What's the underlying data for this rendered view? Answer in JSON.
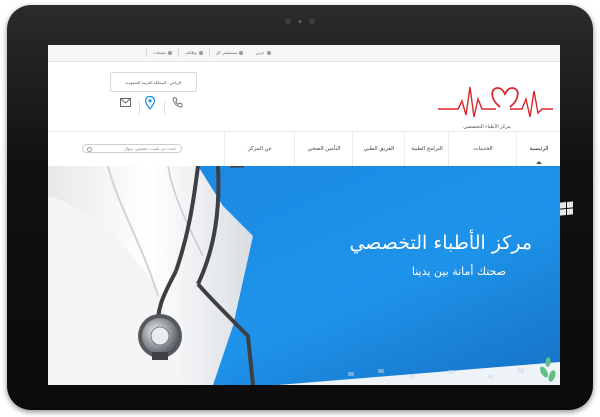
{
  "top_links": [
    {
      "label": "عربي",
      "icon": "globe-icon"
    },
    {
      "label": "مستشفى كل",
      "icon": "phone-icon"
    },
    {
      "label": "وظائف",
      "icon": "briefcase-icon"
    },
    {
      "label": "صفحات",
      "icon": "doc-icon"
    }
  ],
  "logo": {
    "text": "مركز الأطباء التخصصي",
    "color": "#d8262e"
  },
  "contact": {
    "address": "الرياض - المملكة العربية السعودية"
  },
  "nav": {
    "items": [
      "الرئيسية",
      "الخدمات",
      "البرامج الطبية",
      "الفريق الطبي",
      "التأمين الصحي",
      "عن المركز"
    ],
    "active": "الرئيسية"
  },
  "search": {
    "placeholder": "ابحث عن طبيب، تخصص، سؤال"
  },
  "hero": {
    "title": "مركز الأطباء التخصصي",
    "subtitle": "صحتك أمانة بين يدينا",
    "accent": "#1e8fe6"
  },
  "colors": {
    "nav_icon": "#1e8fe6",
    "logo_red": "#d8262e"
  }
}
